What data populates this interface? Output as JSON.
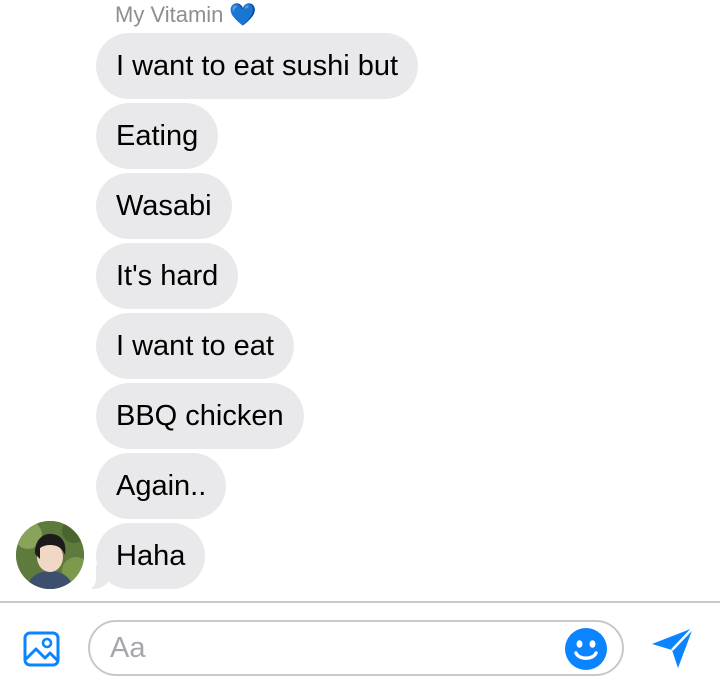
{
  "conversation": {
    "sender_name": "My Vitamin",
    "sender_emoji": "💙",
    "messages": [
      {
        "text": "I want to eat sushi but"
      },
      {
        "text": "Eating"
      },
      {
        "text": "Wasabi"
      },
      {
        "text": "It's hard"
      },
      {
        "text": "I want to eat"
      },
      {
        "text": "BBQ chicken"
      },
      {
        "text": "Again.."
      },
      {
        "text": "Haha"
      }
    ]
  },
  "composer": {
    "placeholder": "Aa"
  },
  "icons": {
    "attach": "image-icon",
    "emoji": "smiley-icon",
    "send": "send-icon"
  },
  "colors": {
    "accent": "#0a84ff",
    "bubble_bg": "#e9e9eb",
    "sender_name": "#8e8e93"
  }
}
